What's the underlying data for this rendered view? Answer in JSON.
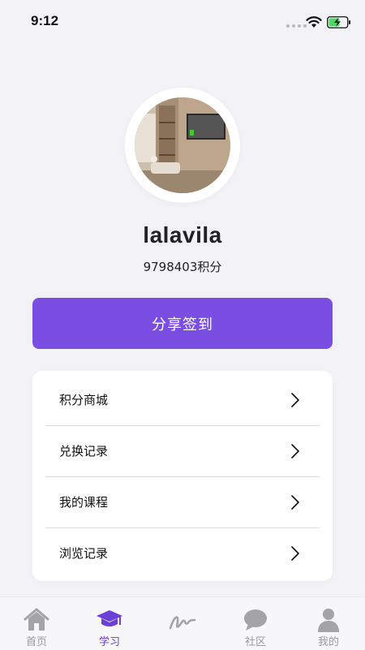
{
  "status_bar": {
    "time": "9:12"
  },
  "profile": {
    "username": "lalavila",
    "points": "9798403积分"
  },
  "checkin_button": {
    "label": "分享签到"
  },
  "menu": {
    "items": [
      {
        "label": "积分商城",
        "icon": "chevron-right-icon"
      },
      {
        "label": "兑换记录",
        "icon": "chevron-right-icon"
      },
      {
        "label": "我的课程",
        "icon": "chevron-right-icon"
      },
      {
        "label": "浏览记录",
        "icon": "chevron-right-icon"
      }
    ]
  },
  "tab_bar": {
    "tabs": [
      {
        "label": "首页",
        "icon": "home-icon",
        "active": false
      },
      {
        "label": "学习",
        "icon": "graduation-cap-icon",
        "active": true
      },
      {
        "label": "",
        "icon": "signature-icon",
        "active": false
      },
      {
        "label": "社区",
        "icon": "chat-bubble-icon",
        "active": false
      },
      {
        "label": "我的",
        "icon": "user-icon",
        "active": false
      }
    ]
  },
  "colors": {
    "accent": "#7a4ee3",
    "active_tab": "#6b3fd8",
    "background": "#f3f3f7",
    "inactive_tab": "#9a9a9f"
  }
}
